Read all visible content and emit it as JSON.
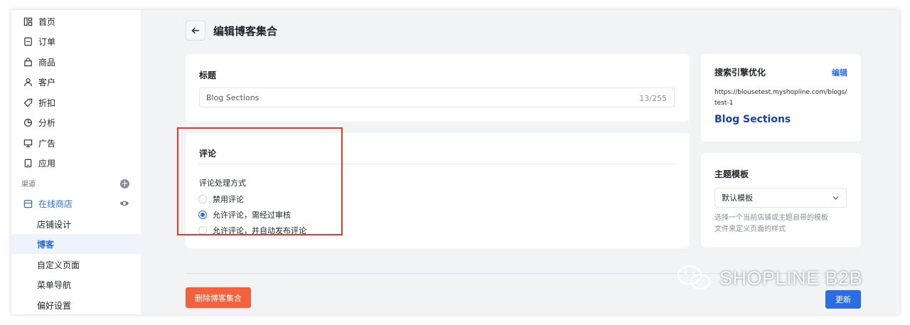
{
  "sidebar": {
    "items": [
      {
        "label": "首页",
        "icon": "dashboard-icon"
      },
      {
        "label": "订单",
        "icon": "order-icon"
      },
      {
        "label": "商品",
        "icon": "bag-icon"
      },
      {
        "label": "客户",
        "icon": "user-icon"
      },
      {
        "label": "折扣",
        "icon": "tag-icon"
      },
      {
        "label": "分析",
        "icon": "pie-chart-icon"
      },
      {
        "label": "广告",
        "icon": "monitor-icon"
      },
      {
        "label": "应用",
        "icon": "app-icon"
      }
    ],
    "section_label": "渠道",
    "online_store": "在线商店",
    "sub_items": [
      "店铺设计",
      "博客",
      "自定义页面",
      "菜单导航",
      "偏好设置"
    ],
    "active_sub": "博客"
  },
  "header": {
    "title": "编辑博客集合"
  },
  "title_card": {
    "label": "标题",
    "input_value": "Blog Sections",
    "counter": "13/255"
  },
  "comments_card": {
    "heading": "评论",
    "method_label": "评论处理方式",
    "options": [
      "禁用评论",
      "允许评论，需经过审核",
      "允许评论，并自动发布评论"
    ],
    "selected_index": 1
  },
  "seo_card": {
    "heading": "搜索引擎优化",
    "edit_link": "编辑",
    "url_line1": "https://blousetest.myshopline.com/blogs/",
    "url_line2": "test-1",
    "page_title": "Blog Sections"
  },
  "theme_card": {
    "heading": "主题模板",
    "select_value": "默认模板",
    "help_line1": "选择一个当前店铺或主题自带的模板",
    "help_line2": "文件来定义页面的样式"
  },
  "footer": {
    "delete_label": "删除博客集合",
    "update_label": "更新"
  },
  "watermark": "SHOPLINE B2B",
  "colors": {
    "accent": "#2b6de5",
    "danger": "#f2623f",
    "highlight_box": "#e53a2c",
    "seo_title": "#1c3fae"
  }
}
